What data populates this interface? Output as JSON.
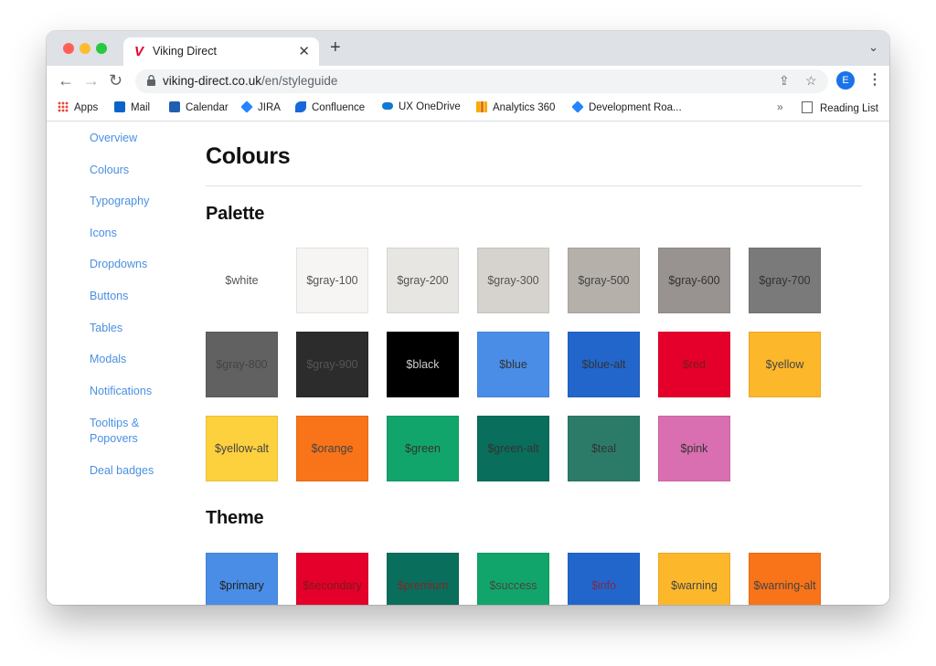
{
  "browser": {
    "tab_title": "Viking Direct",
    "tab_logo": "V",
    "url_host": "viking-direct.co.uk",
    "url_path": "/en/styleguide",
    "avatar_letter": "E"
  },
  "bookmarks": [
    "Apps",
    "Mail",
    "Calendar",
    "JIRA",
    "Confluence",
    "UX OneDrive",
    "Analytics 360",
    "Development Roa..."
  ],
  "reading_list": "Reading List",
  "sidebar": [
    "Overview",
    "Colours",
    "Typography",
    "Icons",
    "Dropdowns",
    "Buttons",
    "Tables",
    "Modals",
    "Notifications",
    "Tooltips &\nPopovers",
    "Deal badges"
  ],
  "page": {
    "title": "Colours",
    "palette_heading": "Palette",
    "theme_heading": "Theme"
  },
  "palette": [
    {
      "label": "$white",
      "color": "#ffffff",
      "text": "#555555"
    },
    {
      "label": "$gray-100",
      "color": "#f6f5f3",
      "text": "#555555"
    },
    {
      "label": "$gray-200",
      "color": "#e8e6e3",
      "text": "#555555"
    },
    {
      "label": "$gray-300",
      "color": "#d6d3ce",
      "text": "#555555"
    },
    {
      "label": "$gray-500",
      "color": "#b5b0aa",
      "text": "#444444"
    },
    {
      "label": "$gray-600",
      "color": "#989290",
      "text": "#333333"
    },
    {
      "label": "$gray-700",
      "color": "#7a7a7a",
      "text": "#333333"
    },
    {
      "label": "$gray-800",
      "color": "#616161",
      "text": "#444444"
    },
    {
      "label": "$gray-900",
      "color": "#2c2c2c",
      "text": "#555555"
    },
    {
      "label": "$black",
      "color": "#000000",
      "text": "#cccccc"
    },
    {
      "label": "$blue",
      "color": "#4a8de6",
      "text": "#333333"
    },
    {
      "label": "$blue-alt",
      "color": "#2266cc",
      "text": "#333333"
    },
    {
      "label": "$red",
      "color": "#e4002b",
      "text": "#7a1a1a"
    },
    {
      "label": "$yellow",
      "color": "#fdb72b",
      "text": "#444444"
    },
    {
      "label": "$yellow-alt",
      "color": "#fdd03e",
      "text": "#444444"
    },
    {
      "label": "$orange",
      "color": "#f97319",
      "text": "#444444"
    },
    {
      "label": "$green",
      "color": "#12a56b",
      "text": "#333333"
    },
    {
      "label": "$green-alt",
      "color": "#0a6e5c",
      "text": "#333333"
    },
    {
      "label": "$teal",
      "color": "#2c7b69",
      "text": "#333333"
    },
    {
      "label": "$pink",
      "color": "#d96fb0",
      "text": "#333333"
    }
  ],
  "theme": [
    {
      "label": "$primary",
      "color": "#4a8de6",
      "text": "#222222"
    },
    {
      "label": "$secondary",
      "color": "#e4002b",
      "text": "#7a1a1a"
    },
    {
      "label": "$premium",
      "color": "#0a6e5c",
      "text": "#7a2a2a"
    },
    {
      "label": "$success",
      "color": "#12a56b",
      "text": "#444444"
    },
    {
      "label": "$info",
      "color": "#2266cc",
      "text": "#7a2a4a"
    },
    {
      "label": "$warning",
      "color": "#fdb72b",
      "text": "#444444"
    },
    {
      "label": "$warning-alt",
      "color": "#f97319",
      "text": "#444444"
    }
  ]
}
